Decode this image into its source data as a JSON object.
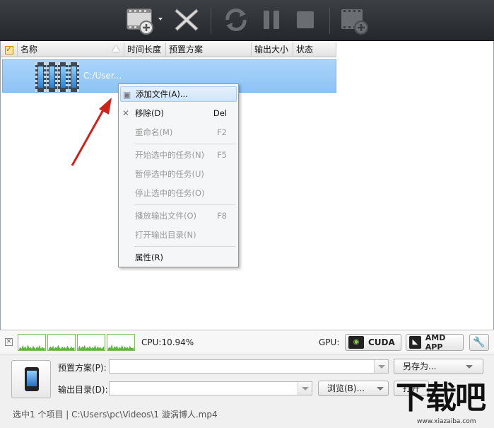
{
  "columns": [
    "名称",
    "时间长度",
    "预置方案",
    "输出大小",
    "状态"
  ],
  "file_row": {
    "path": "C:/User..."
  },
  "menu": {
    "add": {
      "label": "添加文件(A)..."
    },
    "remove": {
      "label": "移除(D)",
      "shortcut": "Del"
    },
    "rename": {
      "label": "重命名(M)",
      "shortcut": "F2"
    },
    "start": {
      "label": "开始选中的任务(N)",
      "shortcut": "F5"
    },
    "pause": {
      "label": "暂停选中的任务(U)"
    },
    "stop": {
      "label": "停止选中的任务(O)"
    },
    "play": {
      "label": "播放输出文件(O)",
      "shortcut": "F8"
    },
    "open_dir": {
      "label": "打开输出目录(N)"
    },
    "props": {
      "label": "属性(R)"
    }
  },
  "perf": {
    "cpu": "CPU:10.94%",
    "gpu_label": "GPU:",
    "cuda": "CUDA",
    "amd": "AMD APP"
  },
  "preset": {
    "label": "预置方案(P):",
    "value": "",
    "save_as": "另存为..."
  },
  "output": {
    "label": "输出目录(D):",
    "value": "",
    "browse": "浏览(B)...",
    "open": "打开"
  },
  "status_text": "选中1 个项目 | C:\\Users\\pc\\Videos\\1 漩涡博人.mp4",
  "watermark": {
    "logo": "下载吧",
    "url": "www.xiazaiba.com"
  },
  "colors": {
    "toolbar": "#2f3236",
    "selection": "#99ccf8",
    "arrow": "#d0201c"
  },
  "icons": [
    "add-video-icon",
    "delete-icon",
    "convert-icon",
    "pause-icon",
    "stop-icon",
    "merge-video-icon"
  ]
}
